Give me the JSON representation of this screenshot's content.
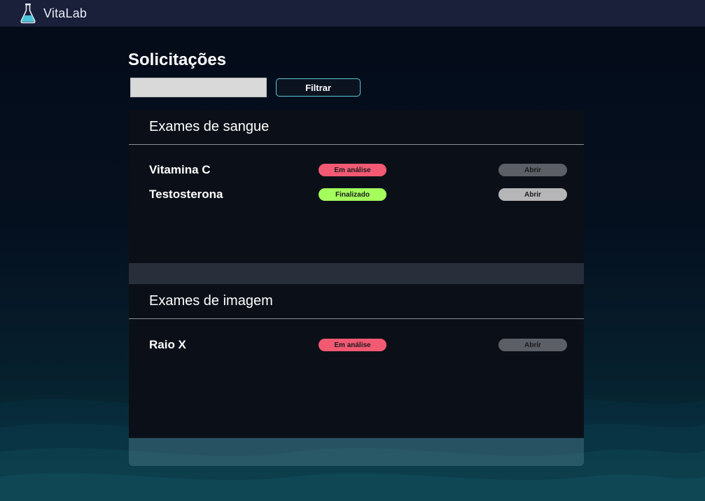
{
  "app": {
    "name": "VitaLab",
    "logo_icon": "flask-icon"
  },
  "page": {
    "title": "Solicitações"
  },
  "filter": {
    "input_value": "",
    "button_label": "Filtrar"
  },
  "sections": [
    {
      "title": "Exames de sangue",
      "exams": [
        {
          "name": "Vitamina C",
          "status": "Em análise",
          "status_color": "#f25a73",
          "open_label": "Abrir"
        },
        {
          "name": "Testosterona",
          "status": "Finalizado",
          "status_color": "#a4ff5c",
          "open_label": "Abrir"
        }
      ]
    },
    {
      "title": "Exames de imagem",
      "exams": [
        {
          "name": "Raio X",
          "status": "Em análise",
          "status_color": "#f25a73",
          "open_label": "Abrir"
        }
      ]
    }
  ],
  "colors": {
    "topbar": "#1a1f3a",
    "card": "#0b1018",
    "accent": "#5cc9d6"
  }
}
